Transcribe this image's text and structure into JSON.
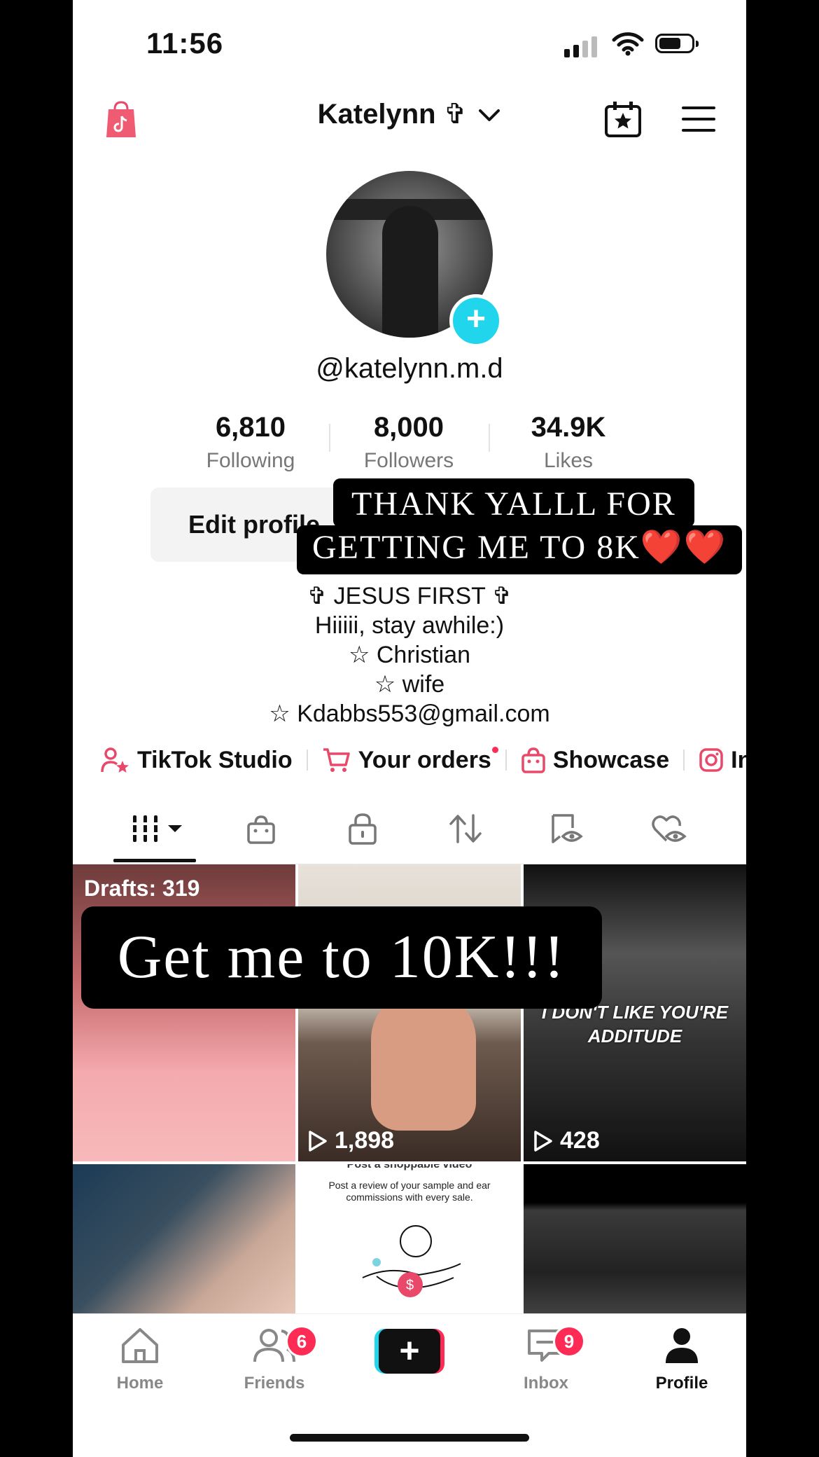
{
  "status_bar": {
    "time": "11:56"
  },
  "header": {
    "display_name": "Katelynn ✞"
  },
  "profile": {
    "handle": "@katelynn.m.d",
    "stats": [
      {
        "value": "6,810",
        "label": "Following"
      },
      {
        "value": "8,000",
        "label": "Followers"
      },
      {
        "value": "34.9K",
        "label": "Likes"
      }
    ],
    "edit_label": "Edit profile",
    "bio": [
      "✞ JESUS FIRST ✞",
      "Hiiiii, stay awhile:)",
      "☆ Christian",
      "☆ wife",
      "☆ Kdabbs553@gmail.com"
    ]
  },
  "overlay": {
    "line1": "THANK YALLL FOR",
    "line2": "GETTING ME TO 8K❤️❤️",
    "big": "Get me to 10K!!!"
  },
  "links": [
    {
      "label": "TikTok Studio"
    },
    {
      "label": "Your orders"
    },
    {
      "label": "Showcase"
    },
    {
      "label": "In"
    }
  ],
  "grid": {
    "drafts_label": "Drafts: 319",
    "video2_views": "1,898",
    "video3_views": "428",
    "video3_caption": "I DON'T LIKE YOU'RE ADDITUDE",
    "promo_title": "Post a shoppable video",
    "promo_text": "Post a review of your sample and ear commissions with every sale."
  },
  "nav": {
    "home": "Home",
    "friends": "Friends",
    "friends_badge": "6",
    "inbox": "Inbox",
    "inbox_badge": "9",
    "profile": "Profile"
  },
  "colors": {
    "accent": "#fe2c55",
    "cyan": "#20d5ec",
    "icon_pink": "#e8496a"
  }
}
